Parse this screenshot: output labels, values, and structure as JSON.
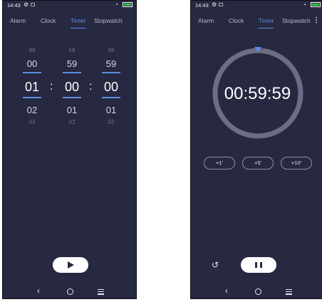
{
  "status_bar": {
    "time": "14:43"
  },
  "tabs": [
    "Alarm",
    "Clock",
    "Timer",
    "Stopwatch"
  ],
  "active_tab": "Timer",
  "left_screen": {
    "picker": {
      "hours": {
        "far_above": "99",
        "above": "00",
        "selected": "01",
        "below": "02",
        "far_below": "03"
      },
      "minutes": {
        "far_above": "58",
        "above": "59",
        "selected": "00",
        "below": "01",
        "far_below": "02"
      },
      "seconds": {
        "far_above": "58",
        "above": "59",
        "selected": "00",
        "below": "01",
        "far_below": "02"
      },
      "separator": ":"
    }
  },
  "right_screen": {
    "countdown": "00:59:59",
    "add_buttons": [
      "+1'",
      "+5'",
      "+10'"
    ]
  },
  "colors": {
    "background": "#272941",
    "accent": "#5b8ee6",
    "ring": "#6b6e84"
  },
  "icons": [
    "gear-icon",
    "wifi-signal-icon",
    "battery-icon",
    "more-options-icon",
    "play-icon",
    "pause-icon",
    "reset-icon",
    "back-icon",
    "home-icon",
    "recents-icon"
  ]
}
